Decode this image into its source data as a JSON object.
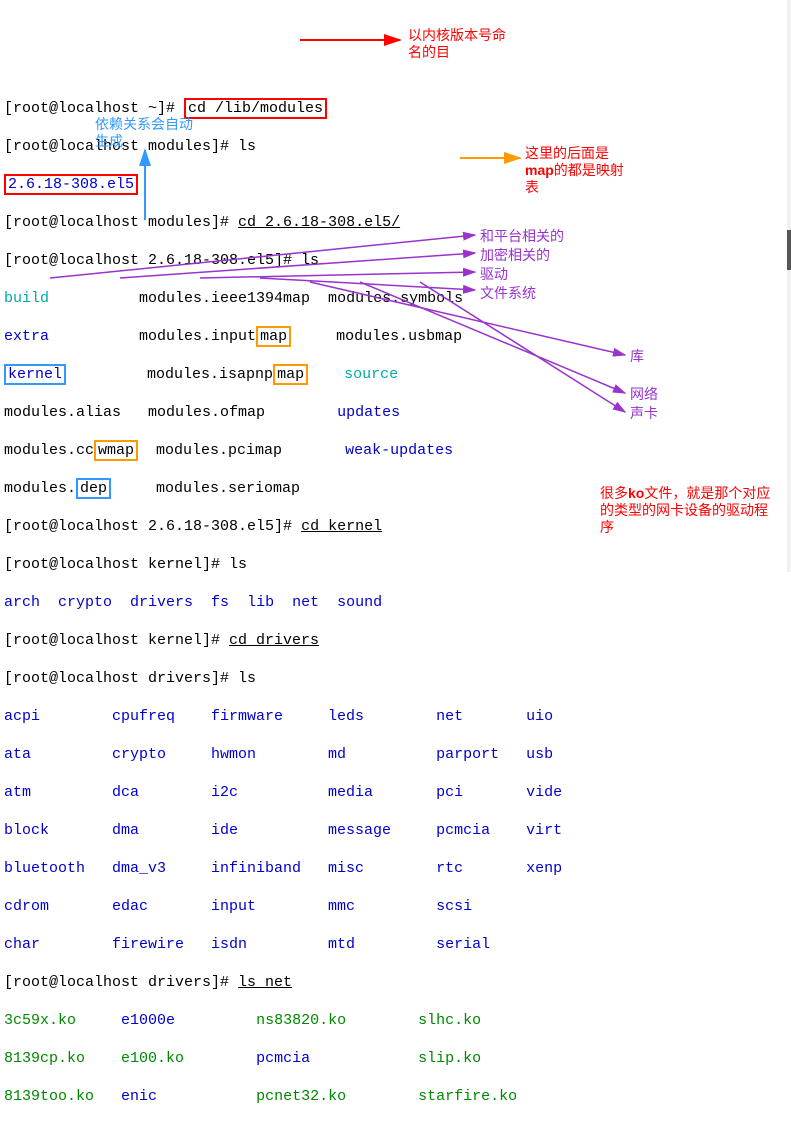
{
  "lines": {
    "l1_prompt": "[root@localhost ~]# ",
    "l1_cmd": "cd /lib/modules",
    "l2": "[root@localhost modules]# ls",
    "l3_version": "2.6.18-308.el5",
    "l4_prompt": "[root@localhost modules]# ",
    "l4_cmd": "cd 2.6.18-308.el5/",
    "l5": "[root@localhost 2.6.18-308.el5]# ls",
    "l6_build": "build",
    "l6_b": "          modules.ieee1394map  modules.symbols",
    "l7_extra": "extra",
    "l7_b": "          modules.input",
    "l7_map1": "map",
    "l7_c": "     modules.usbmap",
    "l8_kernel": "kernel",
    "l8_b": "         modules.isapnp",
    "l8_map2": "map",
    "l8_src": "    source",
    "l9": "modules.alias   modules.ofmap        ",
    "l9_upd": "updates",
    "l10a": "modules.cc",
    "l10_wmap": "wmap",
    "l10b": "  modules.pcimap       ",
    "l10_wu": "weak-updates",
    "l11_a": "modules.",
    "l11_dep": "dep",
    "l11_b": "     modules.seriomap",
    "l12_prompt": "[root@localhost 2.6.18-308.el5]# ",
    "l12_cmd": "cd kernel",
    "l13": "[root@localhost kernel]# ls",
    "l14_arch": "arch",
    "l14_crypto": "  crypto",
    "l14_drivers": "  drivers",
    "l14_fs": "  fs",
    "l14_lib": "  lib",
    "l14_net": "  net",
    "l14_sound": "  sound",
    "l15_prompt": "[root@localhost kernel]# ",
    "l15_cmd": "cd drivers",
    "l16": "[root@localhost drivers]# ls",
    "d1": [
      "acpi",
      "cpufreq",
      "firmware",
      "leds",
      "net",
      "uio"
    ],
    "d2": [
      "ata",
      "crypto",
      "hwmon",
      "md",
      "parport",
      "usb"
    ],
    "d3": [
      "atm",
      "dca",
      "i2c",
      "media",
      "pci",
      "vide"
    ],
    "d4": [
      "block",
      "dma",
      "ide",
      "message",
      "pcmcia",
      "virt"
    ],
    "d5": [
      "bluetooth",
      "dma_v3",
      "infiniband",
      "misc",
      "rtc",
      "xenp"
    ],
    "d6": [
      "cdrom",
      "edac",
      "input",
      "mmc",
      "scsi",
      ""
    ],
    "d7": [
      "char",
      "firewire",
      "isdn",
      "mtd",
      "serial",
      ""
    ],
    "l24_prompt": "[root@localhost drivers]# ",
    "l24_cmd": "ls net",
    "n1": [
      "3c59x.ko",
      "e1000e",
      "ns83820.ko",
      "slhc.ko"
    ],
    "n2": [
      "8139cp.ko",
      "e100.ko",
      "pcmcia",
      "slip.ko"
    ],
    "n3": [
      "8139too.ko",
      "enic",
      "pcnet32.ko",
      "starfire.ko"
    ]
  },
  "annotations": {
    "a_version": "以内核版本号命名的目",
    "a_dep": "依赖关系会自动生成",
    "a_map_pre": "这里的后面是",
    "a_map_word": "map",
    "a_map_post": "的都是映射表",
    "a_arch": "和平台相关的",
    "a_crypto": "加密相关的",
    "a_drivers": "驱动",
    "a_fs": "文件系统",
    "a_lib": "库",
    "a_net": "网络",
    "a_sound": "声卡",
    "a_ko_pre": "很多",
    "a_ko_word": "ko",
    "a_ko_post": "文件，就是那个对应的类型的网卡设备的驱动程序"
  },
  "cols_drivers": [
    0,
    12,
    23,
    36,
    48,
    58
  ],
  "cols_net": [
    0,
    13,
    28,
    46
  ]
}
